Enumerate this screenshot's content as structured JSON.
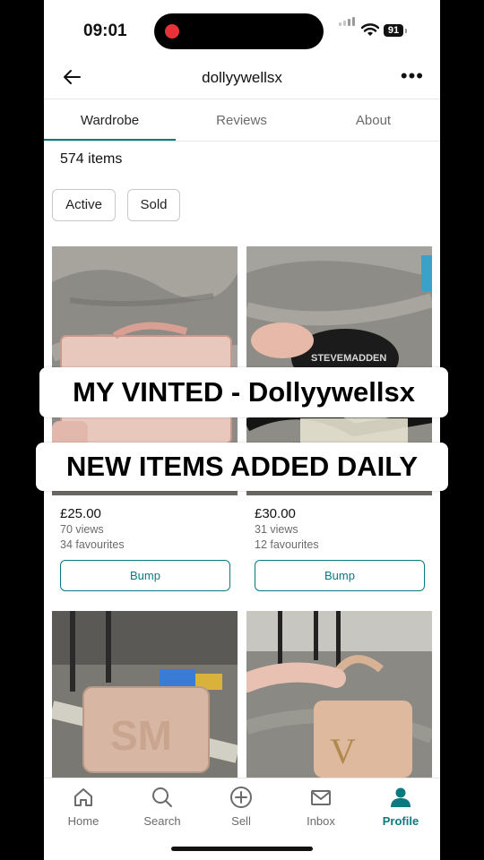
{
  "status_bar": {
    "time": "09:01",
    "battery": "91"
  },
  "header": {
    "username": "dollyywellsx"
  },
  "tabs": [
    {
      "label": "Wardrobe"
    },
    {
      "label": "Reviews"
    },
    {
      "label": "About"
    }
  ],
  "item_count": "574 items",
  "filters": [
    {
      "label": "Active"
    },
    {
      "label": "Sold"
    }
  ],
  "items": [
    {
      "price": "£25.00",
      "views": "70 views",
      "favourites": "34 favourites",
      "action": "Bump"
    },
    {
      "price": "£30.00",
      "views": "31 views",
      "favourites": "12 favourites",
      "action": "Bump",
      "brand_text": "STEVEMADDEN"
    },
    {
      "monogram": "SM"
    },
    {
      "monogram": "V"
    }
  ],
  "overlay": {
    "line1": "MY VINTED - Dollyywellsx",
    "line2": "NEW ITEMS ADDED DAILY"
  },
  "nav": [
    {
      "label": "Home",
      "icon": "home-icon"
    },
    {
      "label": "Search",
      "icon": "search-icon"
    },
    {
      "label": "Sell",
      "icon": "plus-circle-icon"
    },
    {
      "label": "Inbox",
      "icon": "mail-icon"
    },
    {
      "label": "Profile",
      "icon": "person-icon",
      "active": true
    }
  ],
  "colors": {
    "accent": "#0a7a7e",
    "text": "#111111",
    "muted": "#6b6b6b"
  }
}
